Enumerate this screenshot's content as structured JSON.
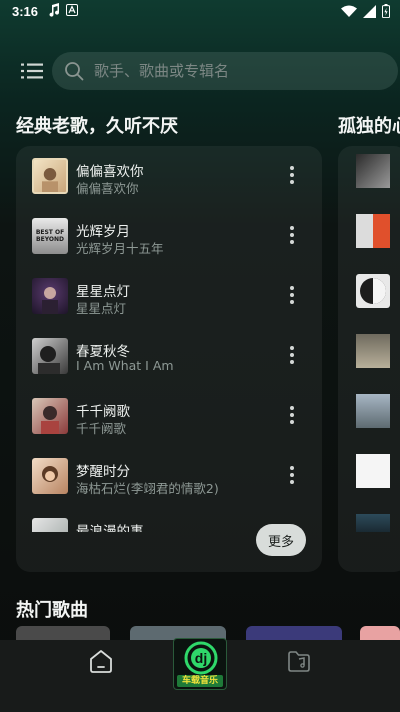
{
  "status_bar": {
    "time": "3:16",
    "left_icons": [
      "music-note-icon",
      "font-a-icon"
    ],
    "right_icons": [
      "wifi-icon",
      "signal-icon",
      "battery-icon"
    ]
  },
  "header": {
    "menu_icon": "list-menu-icon",
    "search": {
      "placeholder": "歌手、歌曲或专辑名",
      "value": ""
    }
  },
  "sections": {
    "classic": {
      "title": "经典老歌，久听不厌",
      "more_label": "更多",
      "songs": [
        {
          "title": "偏偏喜欢你",
          "artist": "偏偏喜欢你"
        },
        {
          "title": "光辉岁月",
          "artist": "光辉岁月十五年",
          "cover_text": "BEST OF BEYOND"
        },
        {
          "title": "星星点灯",
          "artist": "星星点灯"
        },
        {
          "title": "春夏秋冬",
          "artist": "I Am What I Am"
        },
        {
          "title": "千千阙歌",
          "artist": "千千阙歌"
        },
        {
          "title": "梦醒时分",
          "artist": "海枯石烂(李翊君的情歌2)"
        },
        {
          "title": "最浪漫的事",
          "artist": ""
        }
      ]
    },
    "lonely": {
      "title": "孤独的心"
    },
    "hot": {
      "title": "热门歌曲"
    }
  },
  "bottom_nav": {
    "items": [
      {
        "name": "home",
        "icon": "home-icon"
      },
      {
        "name": "logo",
        "icon": "dj-logo-icon",
        "logo_text": "dj",
        "logo_caption": "车载音乐"
      },
      {
        "name": "files",
        "icon": "music-folder-icon"
      }
    ]
  },
  "colors": {
    "accent_green": "#2fd86a",
    "logo_caption": "#f0e23a",
    "background_top": "#0f3b30",
    "background_bottom": "#0b0d0c"
  }
}
